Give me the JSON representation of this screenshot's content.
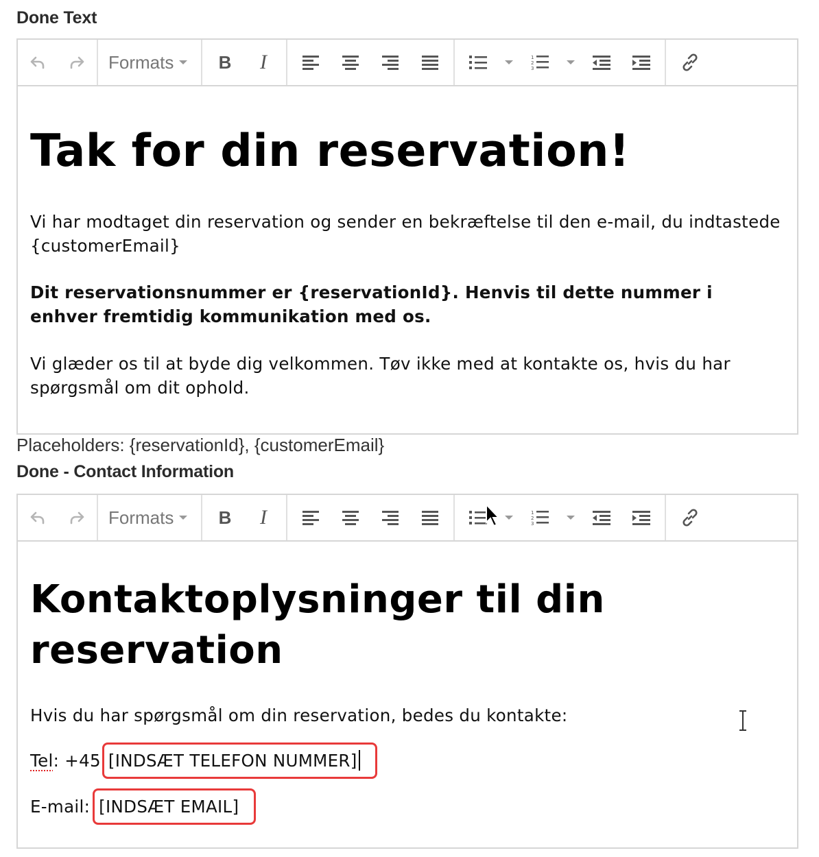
{
  "done_text_label": "Done Text",
  "done_contact_label": "Done - Contact Information",
  "toolbar": {
    "undo_icon": "undo-icon",
    "redo_icon": "redo-icon",
    "formats_label": "Formats",
    "bold_label": "B",
    "italic_label": "I"
  },
  "editor1": {
    "heading": "Tak for din reservation!",
    "para1": "Vi har modtaget din reservation og sender en bekræftelse til den e-mail, du indtastede {customerEmail}",
    "para2": "Dit reservationsnummer er {reservationId}. Henvis til dette nummer i enhver fremtidig kommunikation med os.",
    "para3": "Vi glæder os til at byde dig velkommen. Tøv ikke med at kontakte os, hvis du har spørgsmål om dit ophold."
  },
  "placeholders_help": "Placeholders: {reservationId}, {customerEmail}",
  "editor2": {
    "heading_line1": "Kontaktoplysninger til din",
    "heading_line2": "reservation",
    "intro": "Hvis du har spørgsmål om din reservation, bedes du kontakte:",
    "tel_label": "Tel",
    "tel_prefix": ": +45",
    "tel_placeholder": "[INDSÆT TELEFON NUMMER]",
    "email_label": "E-mail:",
    "email_placeholder": "[INDSÆT EMAIL]"
  },
  "colors": {
    "highlight_box": "#e83a3a",
    "border": "#d6d6d6"
  }
}
